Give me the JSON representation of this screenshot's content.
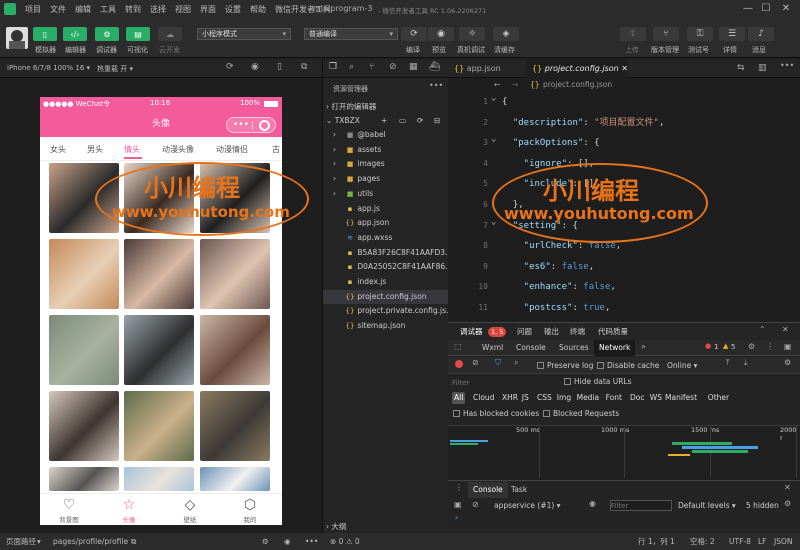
{
  "menu": [
    "项目",
    "文件",
    "编辑",
    "工具",
    "转到",
    "选择",
    "视图",
    "界面",
    "设置",
    "帮助",
    "微信开发者工具"
  ],
  "window": {
    "title": "miniprogram-3",
    "subtitle": "- 微信开发者工具 RC 1.06.2206271"
  },
  "toolbar": {
    "mode_labels": [
      "模拟器",
      "编辑器",
      "调试器",
      "可视化",
      "云开发"
    ],
    "mode_select": "小程序模式",
    "compile_select": "普通编译",
    "right_labels_a": [
      "编译",
      "预览",
      "真机调试",
      "清缓存"
    ],
    "right_labels_b": [
      "上传",
      "版本管理",
      "测试号",
      "详情",
      "消息"
    ]
  },
  "sim": {
    "device": "iPhone 6/7/8 100% 16 ▾",
    "hotreload": "热重载 开 ▾"
  },
  "phone": {
    "carrier": "●●●●● WeChat令",
    "time": "10:16",
    "battery": "100%",
    "title": "头像",
    "tabs": [
      "女头",
      "男头",
      "情头",
      "动漫头像",
      "动漫情侣",
      "古"
    ],
    "active_tab": "情头",
    "tabbar": [
      "背景图",
      "头像",
      "壁纸",
      "我的"
    ],
    "tabbar_active": "头像"
  },
  "explorer": {
    "title": "资源管理器",
    "open_editors": "打开的编辑器",
    "root": "TXBZX",
    "items": [
      {
        "name": "@babel",
        "type": "folder",
        "color": "#888"
      },
      {
        "name": "assets",
        "type": "folder",
        "color": "#d9a83e"
      },
      {
        "name": "images",
        "type": "folder",
        "color": "#d9a83e"
      },
      {
        "name": "pages",
        "type": "folder",
        "color": "#d9a83e"
      },
      {
        "name": "utils",
        "type": "folder",
        "color": "#7cb342"
      },
      {
        "name": "app.js",
        "type": "js"
      },
      {
        "name": "app.json",
        "type": "json"
      },
      {
        "name": "app.wxss",
        "type": "wxss"
      },
      {
        "name": "B5A83F26C8F41AAFD3...",
        "type": "js"
      },
      {
        "name": "D0A25052C8F41AAF86...",
        "type": "js"
      },
      {
        "name": "index.js",
        "type": "js"
      },
      {
        "name": "project.config.json",
        "type": "json",
        "selected": true
      },
      {
        "name": "project.private.config.js...",
        "type": "json"
      },
      {
        "name": "sitemap.json",
        "type": "json"
      }
    ],
    "outline": "大纲"
  },
  "editor": {
    "tabs": [
      "app.json",
      "project.config.json"
    ],
    "active_tab": "project.config.json",
    "breadcrumb": "project.config.json",
    "lines": [
      {
        "n": "1",
        "tokens": [
          [
            "p",
            "{"
          ]
        ]
      },
      {
        "n": "2",
        "tokens": [
          [
            "k",
            "  \"description\""
          ],
          [
            "p",
            ": "
          ],
          [
            "s",
            "\"项目配置文件\""
          ],
          [
            "p",
            ","
          ]
        ]
      },
      {
        "n": "3",
        "tokens": [
          [
            "k",
            "  \"packOptions\""
          ],
          [
            "p",
            ": {"
          ]
        ]
      },
      {
        "n": "4",
        "tokens": [
          [
            "k",
            "    \"ignore\""
          ],
          [
            "p",
            ": [],"
          ]
        ]
      },
      {
        "n": "5",
        "tokens": [
          [
            "k",
            "    \"include\""
          ],
          [
            "p",
            ": []"
          ]
        ]
      },
      {
        "n": "6",
        "tokens": [
          [
            "p",
            "  },"
          ]
        ]
      },
      {
        "n": "7",
        "tokens": [
          [
            "k",
            "  \"setting\""
          ],
          [
            "p",
            ": {"
          ]
        ]
      },
      {
        "n": "8",
        "tokens": [
          [
            "k",
            "    \"urlCheck\""
          ],
          [
            "p",
            ": "
          ],
          [
            "b",
            "false"
          ],
          [
            "p",
            ","
          ]
        ]
      },
      {
        "n": "9",
        "tokens": [
          [
            "k",
            "    \"es6\""
          ],
          [
            "p",
            ": "
          ],
          [
            "b",
            "false"
          ],
          [
            "p",
            ","
          ]
        ]
      },
      {
        "n": "10",
        "tokens": [
          [
            "k",
            "    \"enhance\""
          ],
          [
            "p",
            ": "
          ],
          [
            "b",
            "false"
          ],
          [
            "p",
            ","
          ]
        ]
      },
      {
        "n": "11",
        "tokens": [
          [
            "k",
            "    \"postcss\""
          ],
          [
            "p",
            ": "
          ],
          [
            "b",
            "true"
          ],
          [
            "p",
            ","
          ]
        ]
      }
    ]
  },
  "devtools": {
    "top_tabs": [
      "调试器",
      "问题",
      "输出",
      "终端",
      "代码质量"
    ],
    "badge": "1, 5",
    "tabs": [
      "Wxml",
      "Console",
      "Sources",
      "Network"
    ],
    "active_tab": "Network",
    "err_count": "1",
    "warn_count": "5",
    "preserve_log": "Preserve log",
    "disable_cache": "Disable cache",
    "online": "Online",
    "filter_placeholder": "Filter",
    "hide_data_urls": "Hide data URLs",
    "types": [
      "All",
      "Cloud",
      "XHR",
      "JS",
      "CSS",
      "Img",
      "Media",
      "Font",
      "Doc",
      "WS",
      "Manifest",
      "Other"
    ],
    "blocked_cookies": "Has blocked cookies",
    "blocked_requests": "Blocked Requests",
    "ticks": [
      "500 ms",
      "1000 ms",
      "1500 ms",
      "2000 r"
    ],
    "console_tabs": [
      "Console",
      "Task"
    ],
    "context": "appservice (#1)",
    "console_filter": "Filter",
    "levels": "Default levels",
    "hidden": "5 hidden"
  },
  "status": {
    "page_path_label": "页面路径",
    "page_path": "pages/profile/profile",
    "problems": "⊗ 0 ⚠ 0",
    "cursor": "行 1，列 1",
    "spaces": "空格: 2",
    "encoding": "UTF-8",
    "eol": "LF",
    "lang": "JSON"
  },
  "watermark": {
    "cn": "小川编程",
    "url": "www.youhutong.com"
  }
}
